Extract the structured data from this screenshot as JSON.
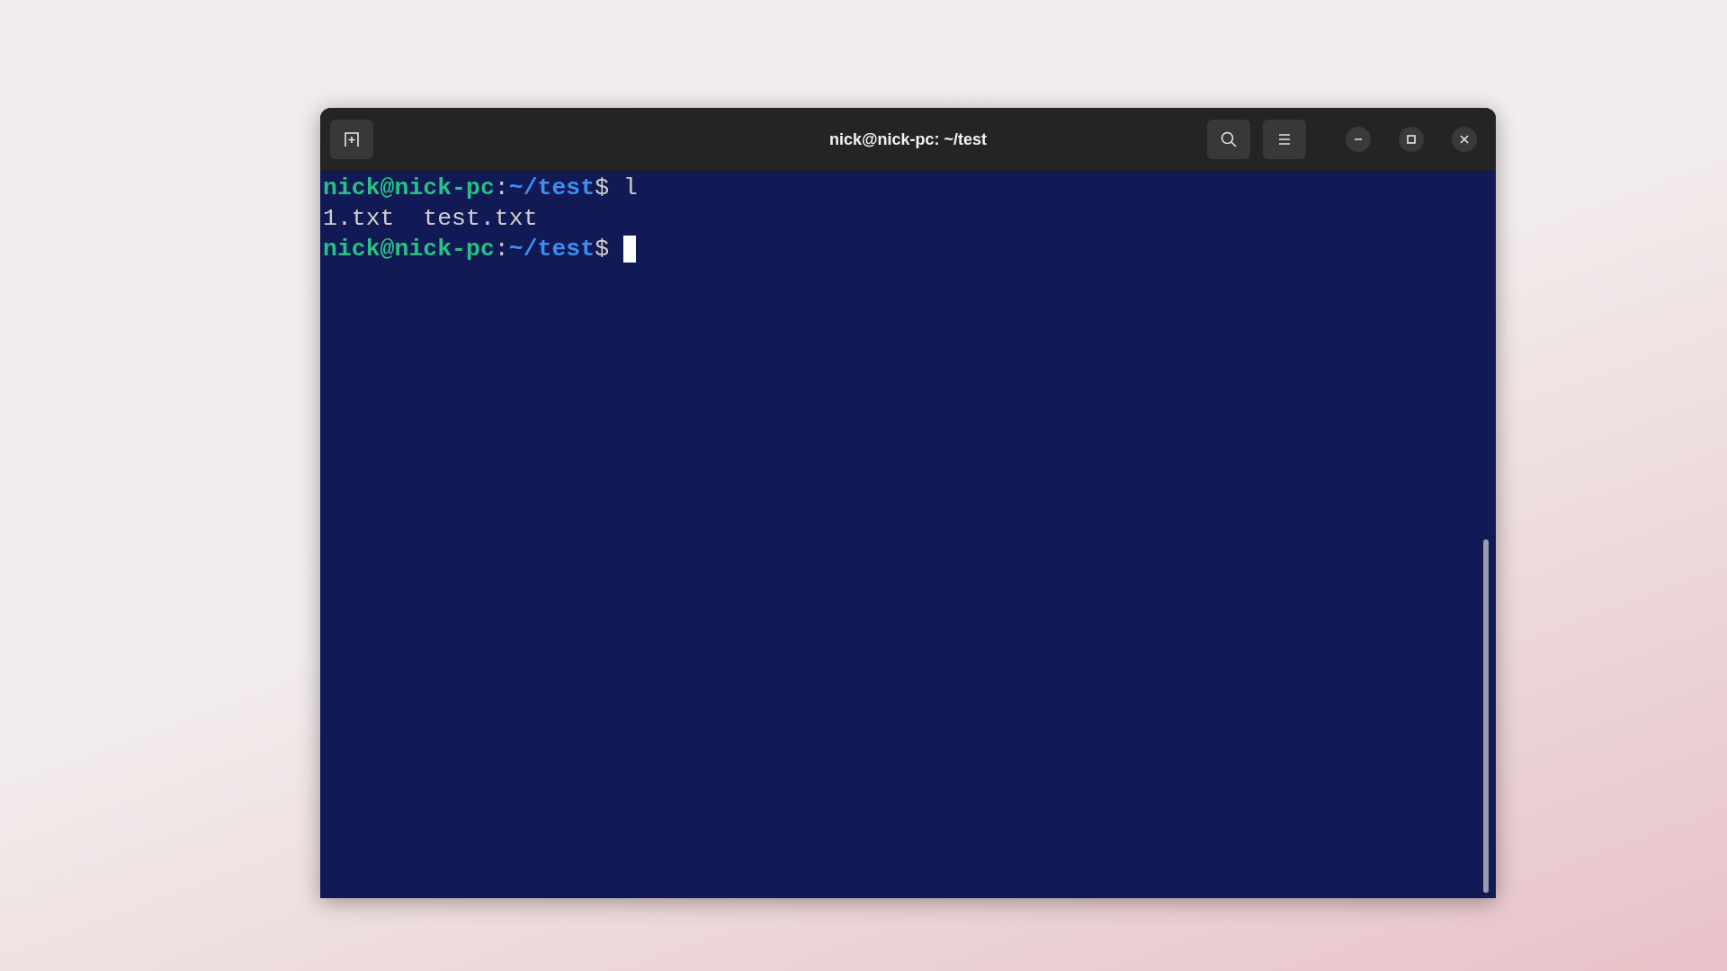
{
  "window": {
    "title": "nick@nick-pc: ~/test"
  },
  "terminal": {
    "lines": [
      {
        "kind": "prompt",
        "user_host": "nick@nick-pc",
        "separator": ":",
        "path": "~/test",
        "symbol": "$",
        "command": "l"
      },
      {
        "kind": "output",
        "text": "1.txt  test.txt"
      },
      {
        "kind": "prompt",
        "user_host": "nick@nick-pc",
        "separator": ":",
        "path": "~/test",
        "symbol": "$",
        "cursor": true
      }
    ]
  }
}
